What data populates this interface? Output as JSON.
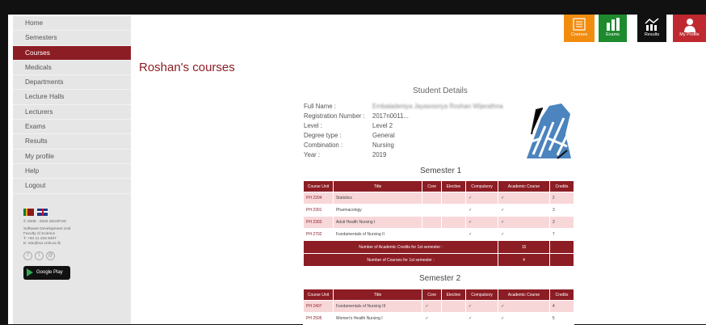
{
  "sidebar": {
    "items": [
      "Home",
      "Semesters",
      "Courses",
      "Medicals",
      "Departments",
      "Lecture Halls",
      "Lecturers",
      "Exams",
      "Results",
      "My profile",
      "Help",
      "Logout"
    ],
    "active": "Courses",
    "footer_lines": [
      "© 2008 - 2020 SDU/FOS",
      "Software Development Unit",
      "Faculty of Science",
      "T: +94 11 215 8407",
      "E: sdu@sci.cmb.ac.lk"
    ],
    "google_play": "Google Play"
  },
  "top_buttons": [
    {
      "label": "Courses",
      "color": "#f28c0f",
      "icon": "book-list-icon"
    },
    {
      "label": "Exams",
      "color": "#1e8a2e",
      "icon": "bar-chart-icon"
    },
    {
      "label": "Results",
      "color": "#111111",
      "icon": "results-chart-icon"
    },
    {
      "label": "My Profile",
      "color": "#c0282f",
      "icon": "user-icon"
    }
  ],
  "page_title": "Roshan's courses",
  "student": {
    "heading": "Student Details",
    "fields": [
      {
        "label": "Full Name :",
        "value": "Embaladeniya Jayasooriya Roshan Wijerathna"
      },
      {
        "label": "Registration Number :",
        "value": "2017n0011..."
      },
      {
        "label": "Level :",
        "value": "Level 2"
      },
      {
        "label": "Degree type :",
        "value": "General"
      },
      {
        "label": "Combination :",
        "value": "Nursing"
      },
      {
        "label": "Year :",
        "value": "2019"
      }
    ]
  },
  "table_headers": [
    "Course Unit",
    "Title",
    "Core",
    "Elective",
    "Compulsory",
    "Academic Course",
    "Credits"
  ],
  "semesters": [
    {
      "title": "Semester 1",
      "rows": [
        {
          "code": "PH 2204",
          "title": "Statistics",
          "core": "",
          "elective": "",
          "compulsory": "✓",
          "academic": "✓",
          "credits": "2"
        },
        {
          "code": "PH 2301",
          "title": "Pharmacology",
          "core": "",
          "elective": "",
          "compulsory": "✓",
          "academic": "✓",
          "credits": "3"
        },
        {
          "code": "PH 2303",
          "title": "Adult Health Nursing I",
          "core": "",
          "elective": "",
          "compulsory": "✓",
          "academic": "✓",
          "credits": "3"
        },
        {
          "code": "PH 2702",
          "title": "Fundamentals of Nursing II",
          "core": "",
          "elective": "",
          "compulsory": "✓",
          "academic": "✓",
          "credits": "7"
        }
      ],
      "summary": [
        {
          "label": "Number of Academic Credits for 1st semester :",
          "value": "15"
        },
        {
          "label": "Number of Courses for 1st semester :",
          "value": "4"
        }
      ]
    },
    {
      "title": "Semester 2",
      "rows": [
        {
          "code": "PH 2407",
          "title": "Fundamentals of Nursing III",
          "core": "✓",
          "elective": "",
          "compulsory": "✓",
          "academic": "✓",
          "credits": "4"
        },
        {
          "code": "PH 2505",
          "title": "Women's Health Nursing I",
          "core": "✓",
          "elective": "",
          "compulsory": "✓",
          "academic": "✓",
          "credits": "5"
        }
      ]
    }
  ]
}
